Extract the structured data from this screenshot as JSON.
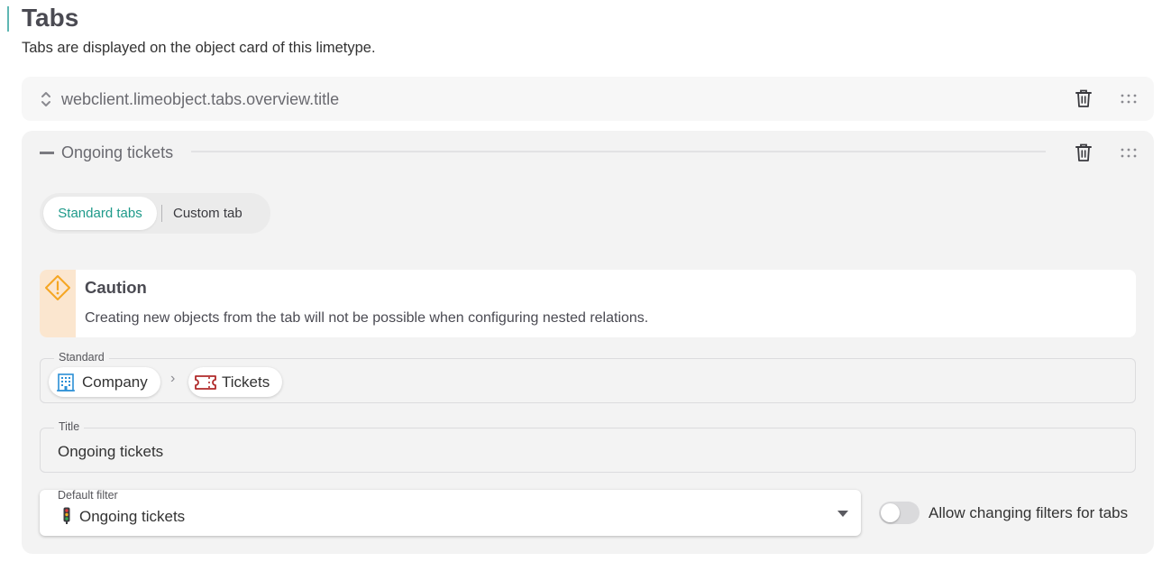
{
  "header": {
    "title": "Tabs",
    "description": "Tabs are displayed on the object card of this limetype."
  },
  "tabs": [
    {
      "title": "webclient.limeobject.tabs.overview.title",
      "state": "collapsed",
      "icons": {
        "expand": "chevron-up-down-icon",
        "delete": "trash-icon",
        "drag": "drag-handle-icon"
      }
    },
    {
      "title": "Ongoing tickets",
      "state": "expanded",
      "icons": {
        "collapse": "minus-icon",
        "delete": "trash-icon",
        "drag": "drag-handle-icon"
      }
    }
  ],
  "tab_type": {
    "options": [
      "Standard tabs",
      "Custom tab"
    ],
    "selected": "Standard tabs"
  },
  "caution": {
    "title": "Caution",
    "text": "Creating new objects from the tab will not be possible when configuring nested relations.",
    "icon": "warning-diamond-icon",
    "color": "#f5a623"
  },
  "standard": {
    "label": "Standard",
    "path": [
      {
        "label": "Company",
        "icon": "building-icon",
        "color": "#2b8fd6"
      },
      {
        "label": "Tickets",
        "icon": "ticket-icon",
        "color": "#b02a2a"
      }
    ],
    "separator": "›"
  },
  "title_field": {
    "label": "Title",
    "value": "Ongoing tickets"
  },
  "default_filter": {
    "label": "Default filter",
    "value": "Ongoing tickets",
    "icon": "traffic-light-icon"
  },
  "allow_changing_filters": {
    "label": "Allow changing filters for tabs",
    "enabled": false
  },
  "colors": {
    "accent": "#1e9a8a",
    "header_bar": "#5fb7b3",
    "caution_stripe": "#fbe6cf"
  }
}
